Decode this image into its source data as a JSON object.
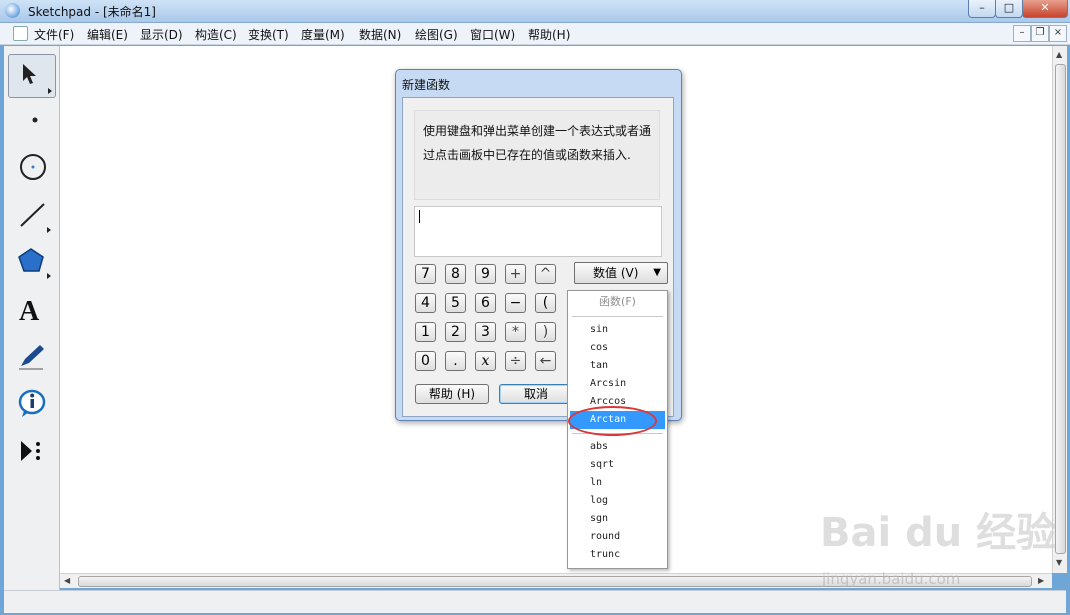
{
  "window": {
    "title": "Sketchpad  - [未命名1]",
    "min": "–",
    "max": "□",
    "close": "✕"
  },
  "menu": {
    "items": [
      "文件(F)",
      "编辑(E)",
      "显示(D)",
      "构造(C)",
      "变换(T)",
      "度量(M)",
      "数据(N)",
      "绘图(G)",
      "窗口(W)",
      "帮助(H)"
    ]
  },
  "mdi": {
    "min": "–",
    "restore": "❐",
    "close": "×"
  },
  "toolbox": {
    "text_tool": "A"
  },
  "dialog": {
    "title": "新建函数",
    "instructions": "使用键盘和弹出菜单创建一个表达式或者通过点击画板中已存在的值或函数来插入.",
    "expression": "",
    "keypad": [
      [
        "7",
        "8",
        "9",
        "+",
        "^"
      ],
      [
        "4",
        "5",
        "6",
        "−",
        "("
      ],
      [
        "1",
        "2",
        "3",
        "*",
        ")"
      ],
      [
        "0",
        ".",
        "x",
        "÷",
        "←"
      ]
    ],
    "dropdown_label": "数值 (V)",
    "help_button": "帮助 (H)",
    "cancel_button": "取消"
  },
  "popup": {
    "header": "函数(F)",
    "group1": [
      "sin",
      "cos",
      "tan",
      "Arcsin",
      "Arccos",
      "Arctan"
    ],
    "group2": [
      "abs",
      "sqrt",
      "ln",
      "log",
      "sgn",
      "round",
      "trunc"
    ],
    "selected": "Arctan",
    "highlight_color": "#3399ff"
  },
  "watermark": {
    "logo": "Bai du 经验",
    "url": "jingyan.baidu.com"
  }
}
